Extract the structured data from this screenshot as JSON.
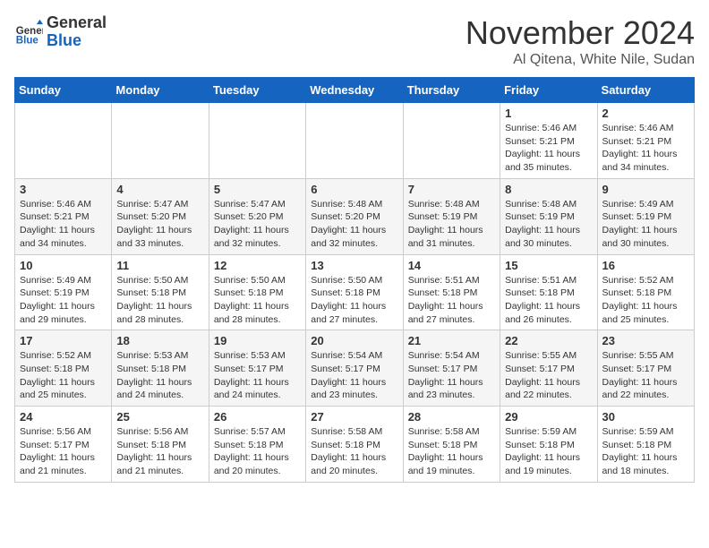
{
  "header": {
    "logo_general": "General",
    "logo_blue": "Blue",
    "title": "November 2024",
    "subtitle": "Al Qitena, White Nile, Sudan"
  },
  "days_of_week": [
    "Sunday",
    "Monday",
    "Tuesday",
    "Wednesday",
    "Thursday",
    "Friday",
    "Saturday"
  ],
  "weeks": [
    [
      {
        "day": "",
        "info": ""
      },
      {
        "day": "",
        "info": ""
      },
      {
        "day": "",
        "info": ""
      },
      {
        "day": "",
        "info": ""
      },
      {
        "day": "",
        "info": ""
      },
      {
        "day": "1",
        "info": "Sunrise: 5:46 AM\nSunset: 5:21 PM\nDaylight: 11 hours and 35 minutes."
      },
      {
        "day": "2",
        "info": "Sunrise: 5:46 AM\nSunset: 5:21 PM\nDaylight: 11 hours and 34 minutes."
      }
    ],
    [
      {
        "day": "3",
        "info": "Sunrise: 5:46 AM\nSunset: 5:21 PM\nDaylight: 11 hours and 34 minutes."
      },
      {
        "day": "4",
        "info": "Sunrise: 5:47 AM\nSunset: 5:20 PM\nDaylight: 11 hours and 33 minutes."
      },
      {
        "day": "5",
        "info": "Sunrise: 5:47 AM\nSunset: 5:20 PM\nDaylight: 11 hours and 32 minutes."
      },
      {
        "day": "6",
        "info": "Sunrise: 5:48 AM\nSunset: 5:20 PM\nDaylight: 11 hours and 32 minutes."
      },
      {
        "day": "7",
        "info": "Sunrise: 5:48 AM\nSunset: 5:19 PM\nDaylight: 11 hours and 31 minutes."
      },
      {
        "day": "8",
        "info": "Sunrise: 5:48 AM\nSunset: 5:19 PM\nDaylight: 11 hours and 30 minutes."
      },
      {
        "day": "9",
        "info": "Sunrise: 5:49 AM\nSunset: 5:19 PM\nDaylight: 11 hours and 30 minutes."
      }
    ],
    [
      {
        "day": "10",
        "info": "Sunrise: 5:49 AM\nSunset: 5:19 PM\nDaylight: 11 hours and 29 minutes."
      },
      {
        "day": "11",
        "info": "Sunrise: 5:50 AM\nSunset: 5:18 PM\nDaylight: 11 hours and 28 minutes."
      },
      {
        "day": "12",
        "info": "Sunrise: 5:50 AM\nSunset: 5:18 PM\nDaylight: 11 hours and 28 minutes."
      },
      {
        "day": "13",
        "info": "Sunrise: 5:50 AM\nSunset: 5:18 PM\nDaylight: 11 hours and 27 minutes."
      },
      {
        "day": "14",
        "info": "Sunrise: 5:51 AM\nSunset: 5:18 PM\nDaylight: 11 hours and 27 minutes."
      },
      {
        "day": "15",
        "info": "Sunrise: 5:51 AM\nSunset: 5:18 PM\nDaylight: 11 hours and 26 minutes."
      },
      {
        "day": "16",
        "info": "Sunrise: 5:52 AM\nSunset: 5:18 PM\nDaylight: 11 hours and 25 minutes."
      }
    ],
    [
      {
        "day": "17",
        "info": "Sunrise: 5:52 AM\nSunset: 5:18 PM\nDaylight: 11 hours and 25 minutes."
      },
      {
        "day": "18",
        "info": "Sunrise: 5:53 AM\nSunset: 5:18 PM\nDaylight: 11 hours and 24 minutes."
      },
      {
        "day": "19",
        "info": "Sunrise: 5:53 AM\nSunset: 5:17 PM\nDaylight: 11 hours and 24 minutes."
      },
      {
        "day": "20",
        "info": "Sunrise: 5:54 AM\nSunset: 5:17 PM\nDaylight: 11 hours and 23 minutes."
      },
      {
        "day": "21",
        "info": "Sunrise: 5:54 AM\nSunset: 5:17 PM\nDaylight: 11 hours and 23 minutes."
      },
      {
        "day": "22",
        "info": "Sunrise: 5:55 AM\nSunset: 5:17 PM\nDaylight: 11 hours and 22 minutes."
      },
      {
        "day": "23",
        "info": "Sunrise: 5:55 AM\nSunset: 5:17 PM\nDaylight: 11 hours and 22 minutes."
      }
    ],
    [
      {
        "day": "24",
        "info": "Sunrise: 5:56 AM\nSunset: 5:17 PM\nDaylight: 11 hours and 21 minutes."
      },
      {
        "day": "25",
        "info": "Sunrise: 5:56 AM\nSunset: 5:18 PM\nDaylight: 11 hours and 21 minutes."
      },
      {
        "day": "26",
        "info": "Sunrise: 5:57 AM\nSunset: 5:18 PM\nDaylight: 11 hours and 20 minutes."
      },
      {
        "day": "27",
        "info": "Sunrise: 5:58 AM\nSunset: 5:18 PM\nDaylight: 11 hours and 20 minutes."
      },
      {
        "day": "28",
        "info": "Sunrise: 5:58 AM\nSunset: 5:18 PM\nDaylight: 11 hours and 19 minutes."
      },
      {
        "day": "29",
        "info": "Sunrise: 5:59 AM\nSunset: 5:18 PM\nDaylight: 11 hours and 19 minutes."
      },
      {
        "day": "30",
        "info": "Sunrise: 5:59 AM\nSunset: 5:18 PM\nDaylight: 11 hours and 18 minutes."
      }
    ]
  ]
}
